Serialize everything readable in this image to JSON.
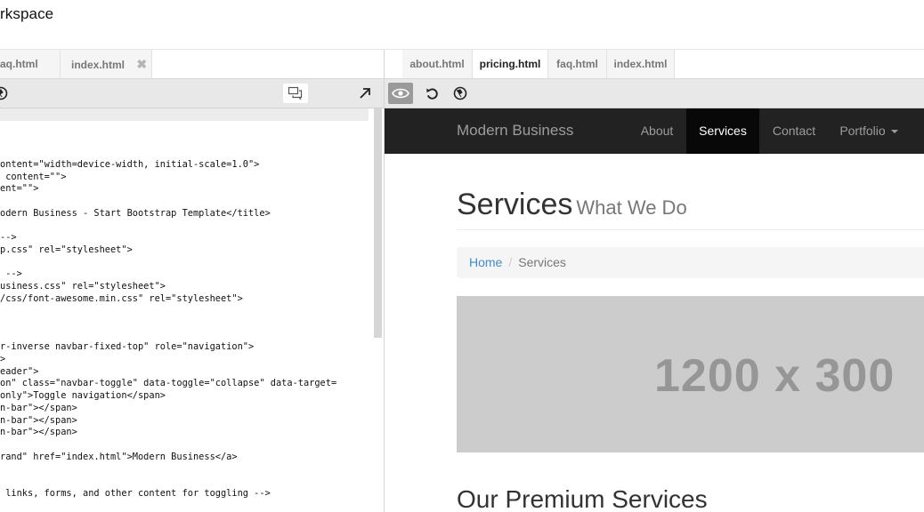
{
  "app": {
    "title": "rkspace"
  },
  "left_tabs": [
    {
      "label": "aq.html"
    },
    {
      "label": "index.html"
    }
  ],
  "code_lines": [
    "",
    "",
    "",
    "",
    "ontent=\"width=device-width, initial-scale=1.0\">",
    " content=\"\">",
    "ent=\"\">",
    "",
    "odern Business - Start Bootstrap Template</title>",
    "",
    "-->",
    "p.css\" rel=\"stylesheet\">",
    "",
    " -->",
    "usiness.css\" rel=\"stylesheet\">",
    "/css/font-awesome.min.css\" rel=\"stylesheet\">",
    "",
    "",
    "",
    "r-inverse navbar-fixed-top\" role=\"navigation\">",
    ">",
    "eader\">",
    "on\" class=\"navbar-toggle\" data-toggle=\"collapse\" data-target=",
    "only\">Toggle navigation</span>",
    "n-bar\"></span>",
    "n-bar\"></span>",
    "n-bar\"></span>",
    "",
    "rand\" href=\"index.html\">Modern Business</a>",
    "",
    "",
    " links, forms, and other content for toggling -->"
  ],
  "right_tabs": [
    {
      "label": "about.html"
    },
    {
      "label": "pricing.html",
      "active": true
    },
    {
      "label": "faq.html"
    },
    {
      "label": "index.html"
    }
  ],
  "site": {
    "brand": "Modern Business",
    "nav": [
      {
        "label": "About"
      },
      {
        "label": "Services",
        "active": true
      },
      {
        "label": "Contact"
      },
      {
        "label": "Portfolio"
      }
    ],
    "page_title": "Services",
    "page_subtitle": "What We Do",
    "breadcrumb": {
      "home": "Home",
      "separator": "/",
      "current": "Services"
    },
    "hero_placeholder": "1200 x 300",
    "section_title": "Our Premium Services"
  },
  "colors": {
    "navbar_bg": "#222222",
    "navbar_active_bg": "#080808",
    "link": "#428bca",
    "hero_bg": "#cccccc"
  }
}
